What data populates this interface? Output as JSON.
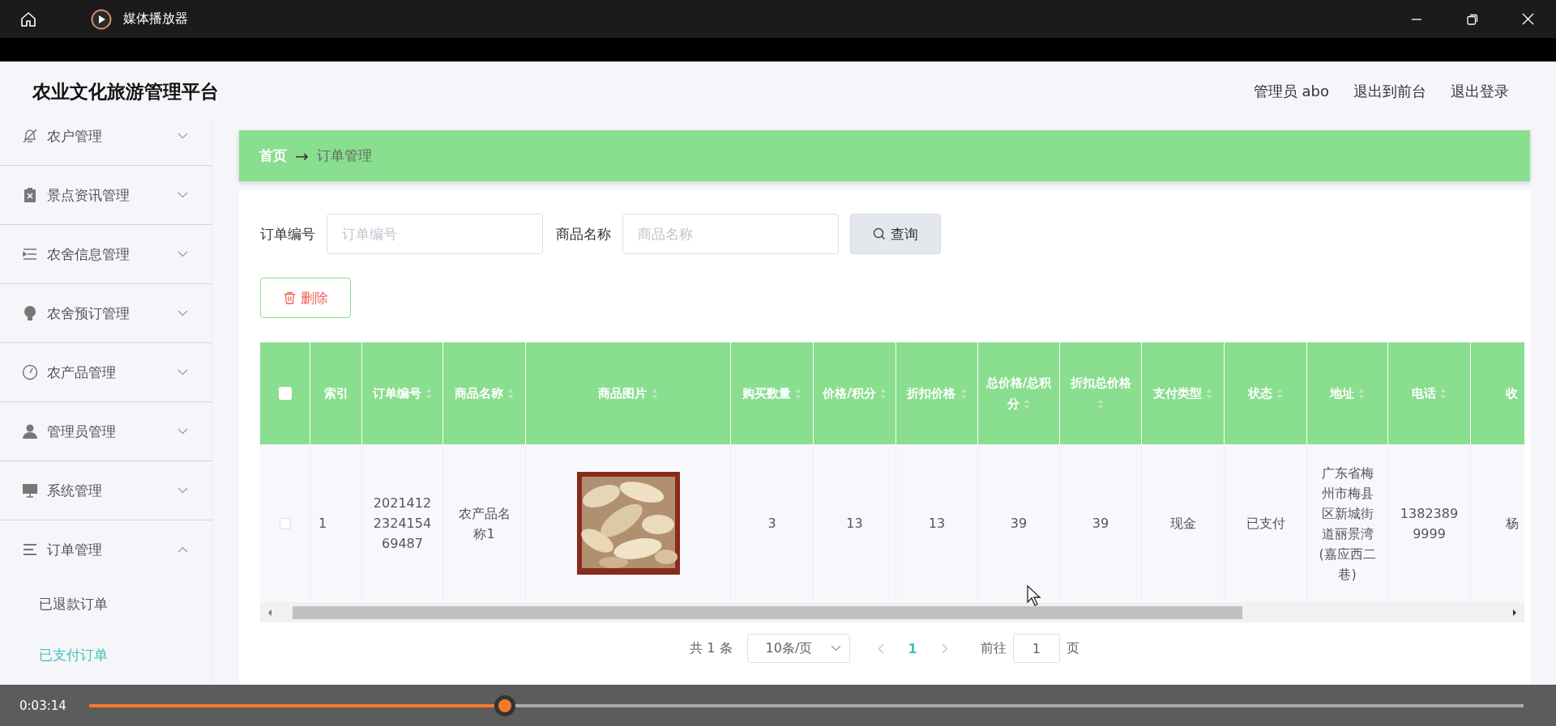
{
  "player": {
    "title": "媒体播放器",
    "current_time": "0:03:14",
    "level": 0.29
  },
  "app": {
    "title": "农业文化旅游管理平台",
    "header_links": [
      "管理员 abo",
      "退出到前台",
      "退出登录"
    ]
  },
  "sidebar": {
    "items": [
      {
        "label": "农户管理",
        "expanded": false
      },
      {
        "label": "景点资讯管理",
        "expanded": false
      },
      {
        "label": "农舍信息管理",
        "expanded": false
      },
      {
        "label": "农舍预订管理",
        "expanded": false
      },
      {
        "label": "农产品管理",
        "expanded": false
      },
      {
        "label": "管理员管理",
        "expanded": false
      },
      {
        "label": "系统管理",
        "expanded": false
      },
      {
        "label": "订单管理",
        "expanded": true,
        "children": [
          {
            "label": "已退款订单",
            "selected": false
          },
          {
            "label": "已支付订单",
            "selected": true
          }
        ]
      }
    ]
  },
  "breadcrumb": {
    "items": [
      {
        "label": "首页",
        "current": false
      },
      {
        "label": "订单管理",
        "current": true
      }
    ],
    "separator": "→"
  },
  "search": {
    "fields": [
      {
        "label": "订单编号",
        "placeholder": "订单编号"
      },
      {
        "label": "商品名称",
        "placeholder": "商品名称"
      }
    ],
    "button": "查询"
  },
  "delete_button": "删除",
  "table": {
    "select_all": {
      "checked": false
    },
    "columns": [
      {
        "label": "索引",
        "sortable": false
      },
      {
        "label": "订单编号",
        "sortable": true
      },
      {
        "label": "商品名称",
        "sortable": true
      },
      {
        "label": "商品图片",
        "sortable": true
      },
      {
        "label": "购买数量",
        "sortable": true
      },
      {
        "label": "价格/积分",
        "sortable": true
      },
      {
        "label": "折扣价格",
        "sortable": true
      },
      {
        "label": "总价格/总积分",
        "sortable": true
      },
      {
        "label": "折扣总价格",
        "sortable": true
      },
      {
        "label": "支付类型",
        "sortable": true
      },
      {
        "label": "状态",
        "sortable": true
      },
      {
        "label": "地址",
        "sortable": true
      },
      {
        "label": "电话",
        "sortable": true
      },
      {
        "label": "收",
        "sortable": false
      }
    ],
    "rows": [
      {
        "checked": false,
        "cells": [
          {
            "kind": "text",
            "text": "1"
          },
          {
            "kind": "text",
            "text": "2021412232415469487"
          },
          {
            "kind": "text",
            "text": "农产品名称1"
          },
          {
            "kind": "picture"
          },
          {
            "kind": "text",
            "text": "3"
          },
          {
            "kind": "text",
            "text": "13"
          },
          {
            "kind": "text",
            "text": "13"
          },
          {
            "kind": "text",
            "text": "39"
          },
          {
            "kind": "text",
            "text": "39"
          },
          {
            "kind": "text",
            "text": "现金"
          },
          {
            "kind": "text",
            "text": "已支付"
          },
          {
            "kind": "text",
            "text": "广东省梅州市梅县区新城街道丽景湾(嘉应西二巷)"
          },
          {
            "kind": "text",
            "text": "13823899999"
          },
          {
            "kind": "text",
            "text": "杨"
          }
        ]
      }
    ]
  },
  "pagination": {
    "total": "共 1 条",
    "page_size": "10条/页",
    "pages": [
      {
        "label": "1",
        "selected": true
      }
    ],
    "goto_label": "前往",
    "goto_value": "1",
    "goto_suffix": "页"
  }
}
